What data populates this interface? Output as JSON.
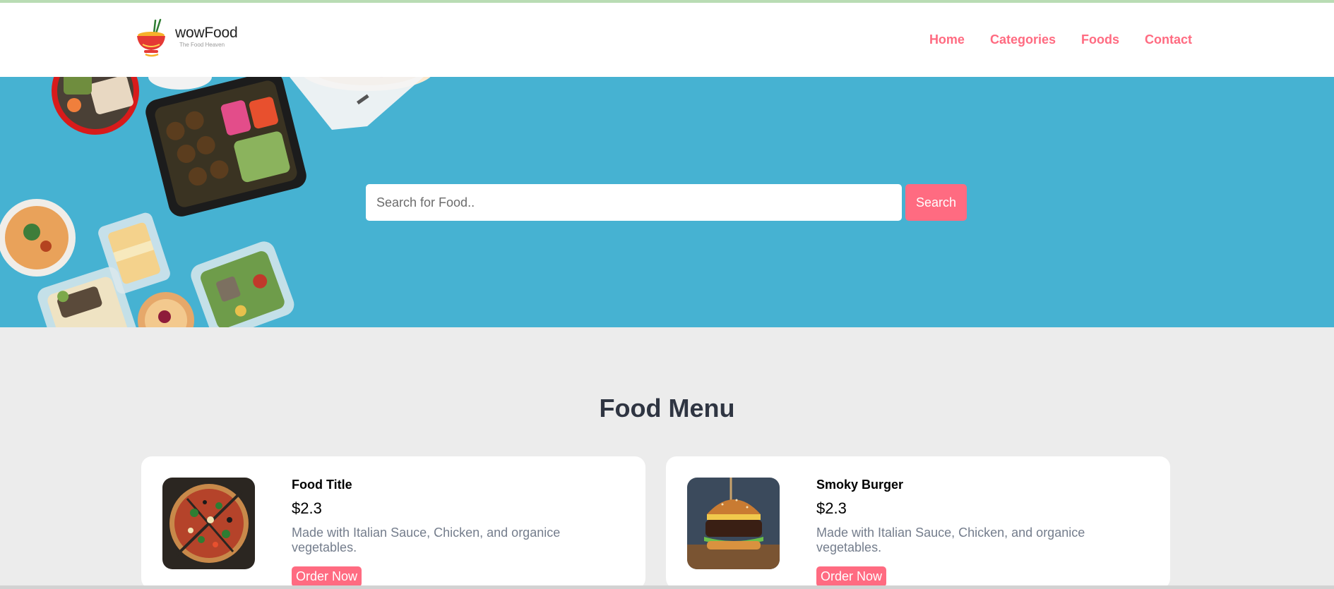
{
  "brand": {
    "name": "wowFood",
    "tagline": "The Food Heaven"
  },
  "nav": {
    "items": [
      {
        "label": "Home"
      },
      {
        "label": "Categories"
      },
      {
        "label": "Foods"
      },
      {
        "label": "Contact"
      }
    ]
  },
  "search": {
    "placeholder": "Search for Food..",
    "value": "",
    "button_label": "Search"
  },
  "food_menu": {
    "heading": "Food Menu",
    "items": [
      {
        "title": "Food Title",
        "price": "$2.3",
        "description": "Made with Italian Sauce, Chicken, and organice vegetables.",
        "button_label": "Order Now",
        "image": "pizza"
      },
      {
        "title": "Smoky Burger",
        "price": "$2.3",
        "description": "Made with Italian Sauce, Chicken, and organice vegetables.",
        "button_label": "Order Now",
        "image": "burger"
      }
    ]
  },
  "colors": {
    "accent": "#ff6b81",
    "hero_bg": "#46b2d2",
    "section_bg": "#ececec",
    "heading": "#2f3542",
    "muted_text": "#747d8c"
  }
}
